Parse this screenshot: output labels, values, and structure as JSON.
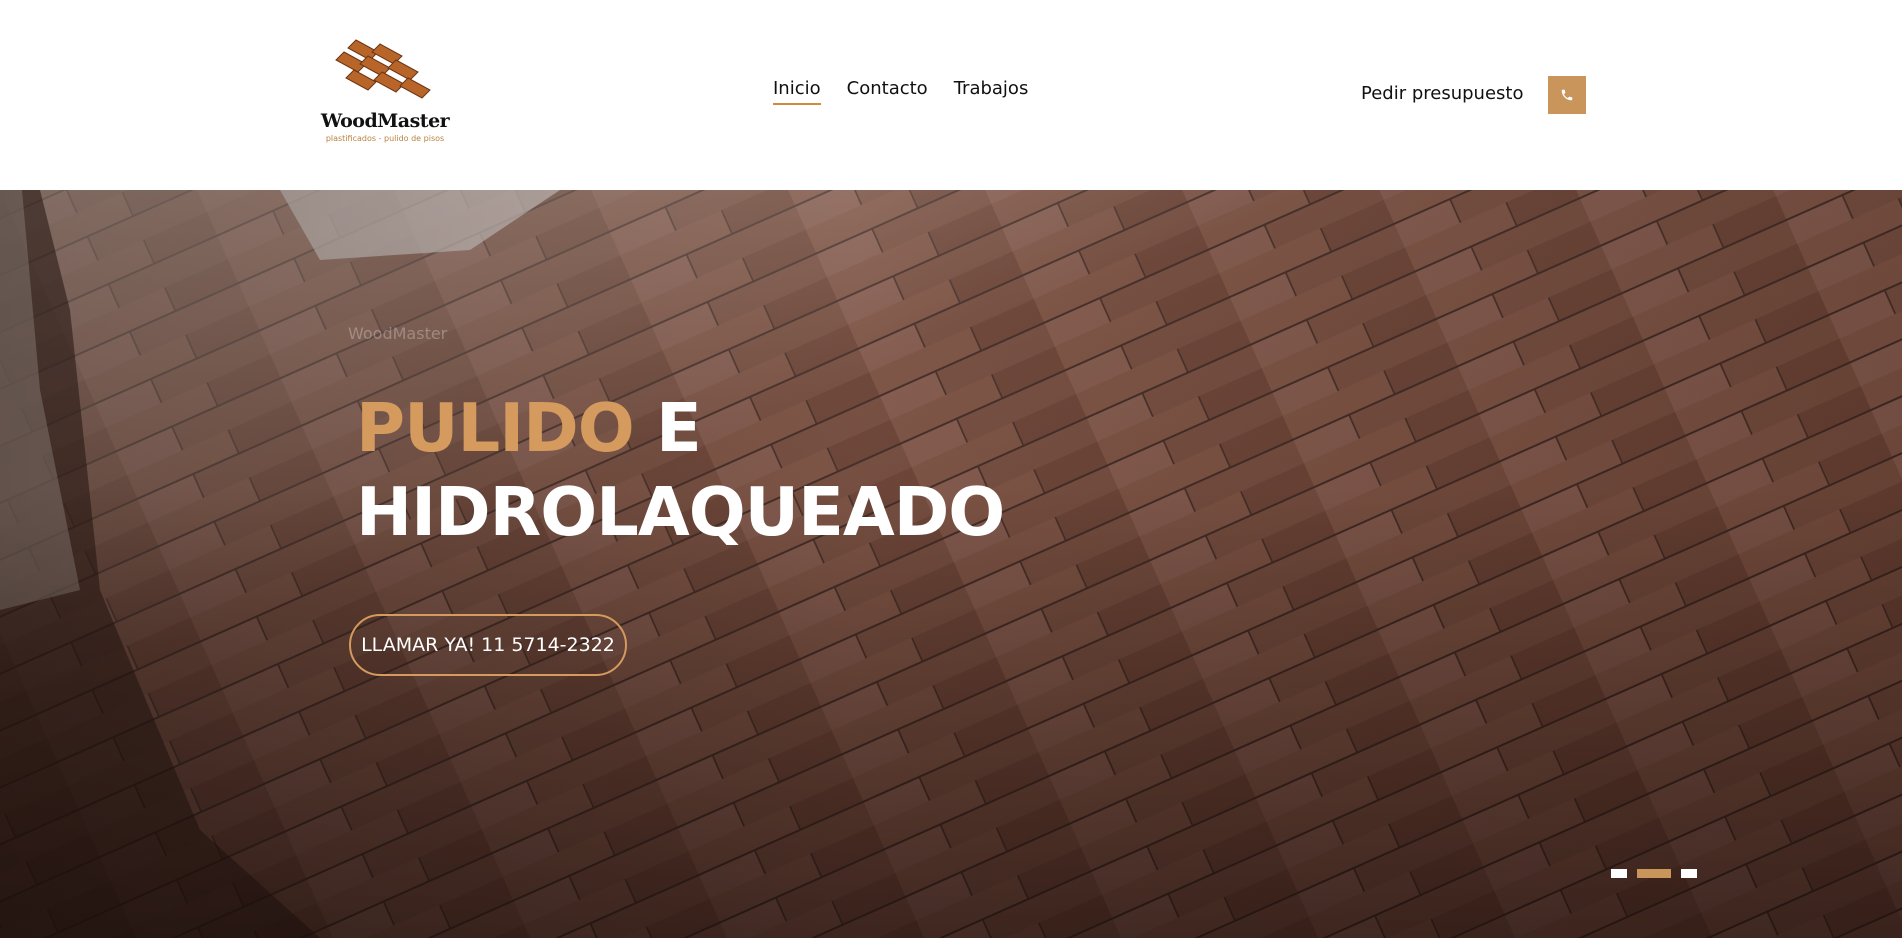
{
  "header": {
    "logo": {
      "name": "WoodMaster",
      "tagline": "plastificados - pulido de pisos"
    },
    "nav": [
      {
        "label": "Inicio",
        "active": true
      },
      {
        "label": "Contacto",
        "active": false
      },
      {
        "label": "Trabajos",
        "active": false
      }
    ],
    "quote_label": "Pedir presupuesto",
    "phone_icon": "phone-icon"
  },
  "hero": {
    "small_label": "WoodMaster",
    "headline_accent": "PULIDO",
    "headline_rest": " E",
    "headline_line2": "HIDROLAQUEADO",
    "cta_label": "LLAMAR YA! 11 5714-2322",
    "slides_total": 3,
    "active_slide": 2
  },
  "colors": {
    "accent": "#c9955b",
    "accent_text": "#d49a5e",
    "nav_underline": "#d08a3d",
    "wood_dark": "#5e3b30"
  }
}
